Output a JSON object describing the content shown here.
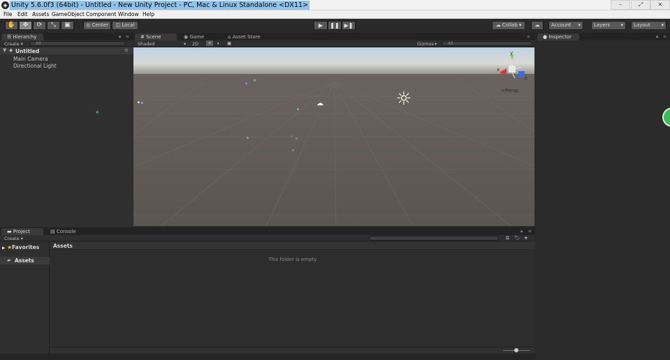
{
  "window": {
    "title": "Unity 5.6.0f3 (64bit) - Untitled - New Unity Project - PC, Mac & Linux Standalone <DX11>",
    "minimize": "–",
    "restore": "⤢",
    "close": "✕"
  },
  "menu": [
    "File",
    "Edit",
    "Assets",
    "GameObject",
    "Component",
    "Window",
    "Help"
  ],
  "toolbar": {
    "tools": [
      "hand-icon",
      "move-icon",
      "rotate-icon",
      "scale-icon",
      "rect-icon"
    ],
    "pivot": "Center",
    "space": "Local",
    "collab": "Collab ▾",
    "account": "Account",
    "layers": "Layers",
    "layout": "Layout"
  },
  "hierarchy": {
    "tab": "Hierarchy",
    "create": "Create ▾",
    "search_placeholder": "All",
    "scene_name": "Untitled",
    "items": [
      "Main Camera",
      "Directional Light"
    ]
  },
  "scene_view": {
    "tabs": [
      "Scene",
      "Game",
      "Asset Store"
    ],
    "shading": "Shaded",
    "mode_2d": "2D",
    "gizmos": "Gizmos",
    "search_placeholder": "All",
    "projection": "Persp",
    "axis_labels": {
      "y": "y",
      "x": "x",
      "z": "z"
    }
  },
  "inspector": {
    "tab": "Inspector"
  },
  "project": {
    "tabs": [
      "Project",
      "Console"
    ],
    "create": "Create ▾",
    "favorites": "Favorites",
    "assets_folder": "Assets",
    "breadcrumb": "Assets",
    "empty_message": "This folder is empty"
  },
  "colors": {
    "accent_selection": "#8ec3ee",
    "panel_bg": "#2d2d2d",
    "scene_ground": "#5d5651",
    "collab_green": "#3dbb55"
  }
}
